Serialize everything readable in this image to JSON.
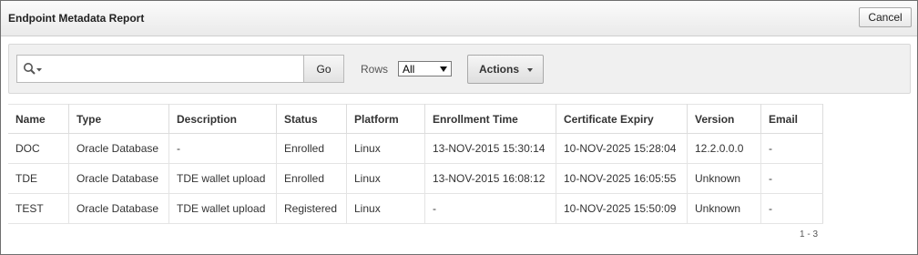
{
  "window": {
    "title": "Endpoint Metadata Report",
    "cancel_label": "Cancel"
  },
  "toolbar": {
    "search_value": "",
    "search_icon": "magnifier-dropdown-icon",
    "go_label": "Go",
    "rows_label": "Rows",
    "rows_value": "All",
    "actions_label": "Actions"
  },
  "table": {
    "headers": [
      "Name",
      "Type",
      "Description",
      "Status",
      "Platform",
      "Enrollment Time",
      "Certificate Expiry",
      "Version",
      "Email"
    ],
    "rows": [
      [
        "DOC",
        "Oracle Database",
        "-",
        "Enrolled",
        "Linux",
        "13-NOV-2015 15:30:14",
        "10-NOV-2025 15:28:04",
        "12.2.0.0.0",
        "-"
      ],
      [
        "TDE",
        "Oracle Database",
        "TDE wallet upload",
        "Enrolled",
        "Linux",
        "13-NOV-2015 16:08:12",
        "10-NOV-2025 16:05:55",
        "Unknown",
        "-"
      ],
      [
        "TEST",
        "Oracle Database",
        "TDE wallet upload",
        "Registered",
        "Linux",
        "-",
        "10-NOV-2025 15:50:09",
        "Unknown",
        "-"
      ]
    ]
  },
  "pagination": {
    "range": "1 - 3"
  }
}
